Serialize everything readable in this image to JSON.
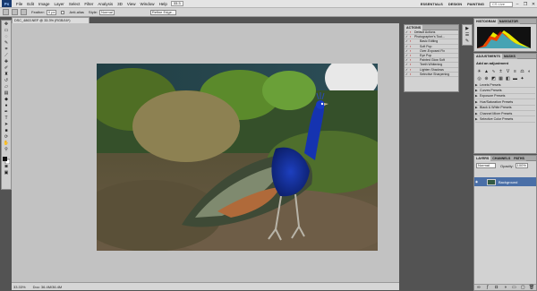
{
  "menubar": {
    "logo": "Ps",
    "items": [
      "File",
      "Edit",
      "Image",
      "Layer",
      "Select",
      "Filter",
      "Analysis",
      "3D",
      "View",
      "Window",
      "Help"
    ],
    "zoom": "33.3",
    "workspaces": [
      "ESSENTIALS",
      "DESIGN",
      "PAINTING"
    ],
    "search_placeholder": "CS Live"
  },
  "options": {
    "feather_label": "Feather:",
    "feather_value": "0 px",
    "antialias_label": "Anti-alias",
    "style_label": "Style:",
    "style_value": "Normal",
    "refine_edge": "Refine Edge..."
  },
  "document": {
    "tab_title": "DSC_4863.NEF @ 33.3% (RGB/16*)",
    "status_zoom": "33.33%",
    "status_doc": "Doc: 36.4M/36.4M"
  },
  "actions": {
    "tabs": [
      "ACTIONS"
    ],
    "rows": [
      {
        "label": "Default Actions",
        "indent": false
      },
      {
        "label": "Photographer's Tool...",
        "indent": false
      },
      {
        "label": "Basic Editing",
        "indent": true
      },
      {
        "label": "Soft Pop",
        "indent": true
      },
      {
        "label": "Over-Exposed Fix",
        "indent": true
      },
      {
        "label": "Eye Pop",
        "indent": true
      },
      {
        "label": "Painted Glow Soft",
        "indent": true
      },
      {
        "label": "Teeth Whitening",
        "indent": true
      },
      {
        "label": "Lighten Shadows",
        "indent": true
      },
      {
        "label": "Selective Sharpening",
        "indent": true
      }
    ]
  },
  "histogram": {
    "tabs": [
      "HISTOGRAM",
      "NAVIGATOR"
    ]
  },
  "adjustments": {
    "tabs": [
      "ADJUSTMENTS",
      "MASKS"
    ],
    "title": "Add an adjustment",
    "presets": [
      "Levels Presets",
      "Curves Presets",
      "Exposure Presets",
      "Hue/Saturation Presets",
      "Black & White Presets",
      "Channel Mixer Presets",
      "Selective Color Presets"
    ]
  },
  "layers": {
    "tabs": [
      "LAYERS",
      "CHANNELS",
      "PATHS"
    ],
    "blend_mode": "Normal",
    "opacity_label": "Opacity:",
    "opacity_value": "100%",
    "layer_name": "Background"
  }
}
